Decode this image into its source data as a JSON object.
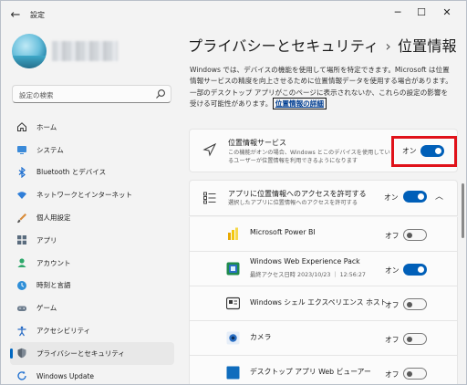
{
  "window": {
    "title": "設定",
    "back_icon": "back-arrow-icon",
    "controls": [
      "minimize-icon",
      "maximize-icon",
      "close-icon"
    ]
  },
  "sidebar": {
    "search_placeholder": "設定の検索",
    "items": [
      {
        "label": "ホーム",
        "icon": "home-icon"
      },
      {
        "label": "システム",
        "icon": "system-icon"
      },
      {
        "label": "Bluetooth とデバイス",
        "icon": "bluetooth-icon"
      },
      {
        "label": "ネットワークとインターネット",
        "icon": "network-icon"
      },
      {
        "label": "個人用設定",
        "icon": "personalization-icon"
      },
      {
        "label": "アプリ",
        "icon": "apps-icon"
      },
      {
        "label": "アカウント",
        "icon": "account-icon"
      },
      {
        "label": "時刻と言語",
        "icon": "time-language-icon"
      },
      {
        "label": "ゲーム",
        "icon": "gaming-icon"
      },
      {
        "label": "アクセシビリティ",
        "icon": "accessibility-icon"
      },
      {
        "label": "プライバシーとセキュリティ",
        "icon": "privacy-shield-icon",
        "active": true
      },
      {
        "label": "Windows Update",
        "icon": "windows-update-icon"
      }
    ]
  },
  "header": {
    "parent": "プライバシーとセキュリティ",
    "separator": "›",
    "current": "位置情報"
  },
  "description": {
    "text": "Windows では、デバイスの機能を使用して場所を特定できます。Microsoft は位置情報サービスの精度を向上させるために位置情報データを使用する場合があります。一部のデスクトップ アプリがこのページに表示されないか、これらの設定の影響を受ける可能性があります。",
    "link": "位置情報の詳細"
  },
  "location_service": {
    "title": "位置情報サービス",
    "subtitle": "この機能がオンの場合、Windows とこのデバイスを使用しているユーザーが位置情報を利用できるようになります",
    "state": "オン",
    "on": true
  },
  "app_access": {
    "title": "アプリに位置情報へのアクセスを許可する",
    "subtitle": "選択したアプリに位置情報へのアクセスを許可する",
    "state": "オン",
    "on": true
  },
  "apps": [
    {
      "name": "Microsoft Power BI",
      "sub": "",
      "state": "オフ",
      "on": false,
      "icon": "power-bi-icon",
      "color": "#f2c811"
    },
    {
      "name": "Windows Web Experience Pack",
      "sub": "最終アクセス日時 2023/10/23 ｜ 12:56:27",
      "state": "オン",
      "on": true,
      "icon": "web-experience-icon",
      "color": "#1f8b4c"
    },
    {
      "name": "Windows シェル エクスペリエンス ホスト",
      "sub": "",
      "state": "オフ",
      "on": false,
      "icon": "shell-host-icon",
      "color": "#3a3a3a"
    },
    {
      "name": "カメラ",
      "sub": "",
      "state": "オフ",
      "on": false,
      "icon": "camera-icon",
      "color": "#2a6fc4"
    },
    {
      "name": "デスクトップ アプリ Web ビューアー",
      "sub": "",
      "state": "オフ",
      "on": false,
      "icon": "web-viewer-icon",
      "color": "#0f6cbd"
    }
  ],
  "colors": {
    "accent": "#005fb8",
    "highlight": "#e0121a"
  }
}
